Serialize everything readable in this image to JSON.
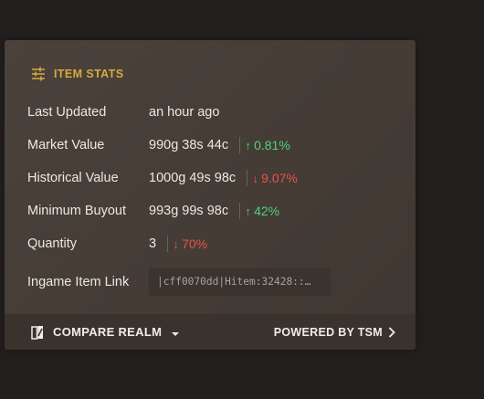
{
  "card": {
    "title": "ITEM STATS",
    "title_icon": "sliders-icon",
    "accent_color": "#d9a93d",
    "up_color": "#4fd17b",
    "down_color": "#e8534f"
  },
  "stats": [
    {
      "label": "Last Updated",
      "value": "an hour ago"
    },
    {
      "label": "Market Value",
      "value": "990g 38s 44c",
      "change": "0.81%",
      "direction": "up",
      "arrow": "↑"
    },
    {
      "label": "Historical Value",
      "value": "1000g 49s 98c",
      "change": "9.07%",
      "direction": "down",
      "arrow": "↓"
    },
    {
      "label": "Minimum Buyout",
      "value": "993g 99s 98c",
      "change": "42%",
      "direction": "up",
      "arrow": "↑"
    },
    {
      "label": "Quantity",
      "value": "3",
      "change": "70%",
      "direction": "down",
      "arrow": "↓"
    }
  ],
  "item_link": {
    "label": "Ingame Item Link",
    "value": "|cff0070dd|Hitem:32428::…"
  },
  "footer": {
    "compare_label": "COMPARE REALM",
    "compare_icon": "compare-realm-icon",
    "powered_label": "POWERED BY TSM",
    "powered_icon": "chevron-right-icon"
  }
}
